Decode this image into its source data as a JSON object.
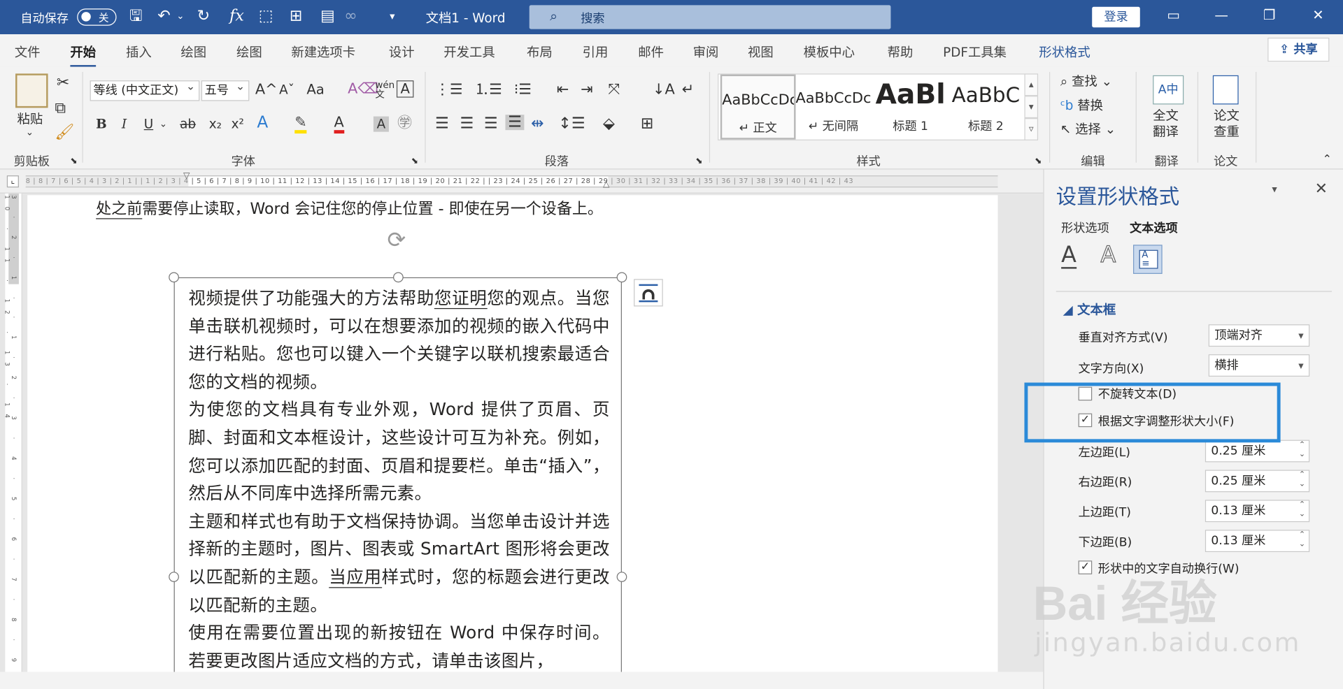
{
  "titlebar": {
    "autosave_label": "自动保存",
    "autosave_state": "关",
    "doc_title": "文档1  -  Word",
    "search_placeholder": "搜索",
    "login": "登录"
  },
  "tabs": [
    "文件",
    "开始",
    "插入",
    "绘图",
    "绘图",
    "新建选项卡",
    "设计",
    "开发工具",
    "布局",
    "引用",
    "邮件",
    "审阅",
    "视图",
    "模板中心",
    "帮助",
    "PDF工具集",
    "形状格式"
  ],
  "share": "共享",
  "ribbon": {
    "clipboard": {
      "paste": "粘贴",
      "group": "剪贴板"
    },
    "font": {
      "name": "等线 (中文正文)",
      "size": "五号",
      "group": "字体",
      "bold": "B",
      "italic": "I",
      "underline": "U",
      "strike": "ab",
      "sub": "x₂",
      "sup": "x²",
      "grow": "A^",
      "shrink": "Aˇ",
      "case": "Aa"
    },
    "paragraph": {
      "group": "段落"
    },
    "styles": {
      "group": "样式",
      "items": [
        {
          "sample": "AaBbCcDc",
          "label": "↵ 正文"
        },
        {
          "sample": "AaBbCcDc",
          "label": "↵ 无间隔"
        },
        {
          "sample": "AaBl",
          "label": "标题 1"
        },
        {
          "sample": "AaBbC",
          "label": "标题 2"
        }
      ]
    },
    "editing": {
      "find": "查找",
      "replace": "替换",
      "select": "选择",
      "group": "编辑"
    },
    "translate": {
      "label1": "全文",
      "label2": "翻译",
      "group": "翻译"
    },
    "paper": {
      "label1": "论文",
      "label2": "查重",
      "group": "论文"
    }
  },
  "ruler_numbers": "8 | 8 | 7 | 6 | 5 | 4 | 3 | 2 | 1 |     | 1 | 2 | 3 | 4 | 5 | 6 | 7 | 8 | 9 | 10 | 11 | 12 | 13 | 14 | 15 | 16 | 17 | 18 | 19 | 20 | 21 | 22 |     | 23 | 24 | 25 | 26 | 27 | 28 | 29 | 30 | 31 | 32 | 33 | 34 | 35 | 36 | 37 | 38 | 39 | 40 | 41 | 42 | 43",
  "vruler_numbers": "3 · 2 · 1 · · 1 · 2 · 3 · 4 · 5 · 6 · 7 · 8 · 9 · 10 · 11 · 12 · 13 · 14",
  "document": {
    "top_line_u": "处之前",
    "top_line_rest": "需要停止读取，Word 会记住您的停止位置 - 即使在另一个设备上。",
    "p1a": "视频提供了功能强大的方法帮助",
    "p1u": "您证明",
    "p1b": "您的观点。当您单击联机视频时，可以在想要添加的视频的嵌入代码中进行粘贴。您也可以键入一个关键字以联机搜索最适合您的文档的视频。",
    "p2": "为使您的文档具有专业外观，Word 提供了页眉、页脚、封面和文本框设计，这些设计可互为补充。例如，您可以添加匹配的封面、页眉和提要栏。单击“插入”，然后从不同库中选择所需元素。",
    "p3a": "主题和样式也有助于文档保持协调。当您单击设计并选择新的主题时，图片、图表或 SmartArt 图形将会更改以匹配新的主题。",
    "p3u": "当应用",
    "p3b": "样式时，您的标题会进行更改以匹配新的主题。",
    "p4": "使用在需要位置出现的新按钮在 Word 中保存时间。若要更改图片适应文档的方式，请单击该图片，"
  },
  "pane": {
    "title": "设置形状格式",
    "tab_shape": "形状选项",
    "tab_text": "文本选项",
    "section": "文本框",
    "valign_label": "垂直对齐方式(V)",
    "valign_value": "顶端对齐",
    "textdir_label": "文字方向(X)",
    "textdir_value": "横排",
    "no_rotate": "不旋转文本(D)",
    "resize": "根据文字调整形状大小(F)",
    "left_label": "左边距(L)",
    "left_value": "0.25 厘米",
    "right_label": "右边距(R)",
    "right_value": "0.25 厘米",
    "top_label": "上边距(T)",
    "top_value": "0.13 厘米",
    "bottom_label": "下边距(B)",
    "bottom_value": "0.13 厘米",
    "wrap": "形状中的文字自动换行(W)"
  },
  "watermark": {
    "brand": "Bai 经验",
    "url": "jingyan.baidu.com"
  }
}
